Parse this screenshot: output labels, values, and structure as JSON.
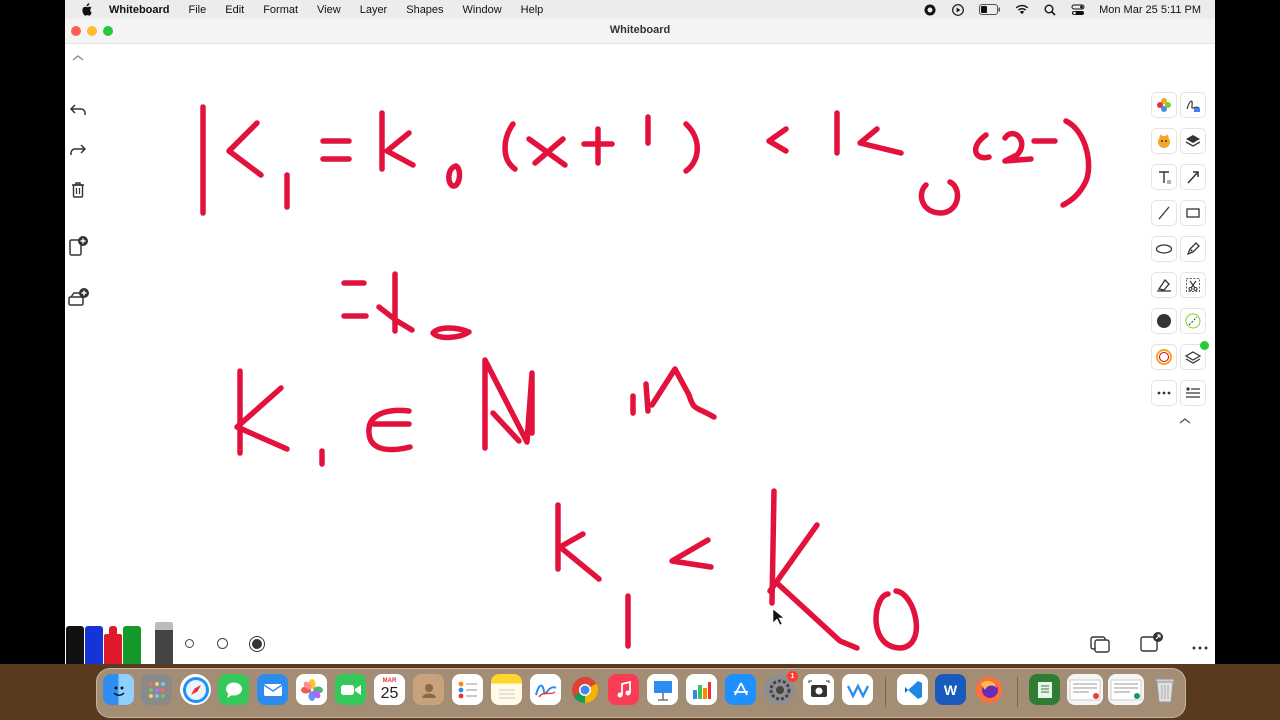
{
  "menubar": {
    "app_name": "Whiteboard",
    "menus": [
      "File",
      "Edit",
      "Format",
      "View",
      "Layer",
      "Shapes",
      "Window",
      "Help"
    ],
    "datetime": "Mon Mar 25  5:11 PM"
  },
  "window": {
    "title": "Whiteboard"
  },
  "dock": {
    "calendar_month": "MAR",
    "calendar_day": "25",
    "settings_badge": "1",
    "word_letter": "W"
  },
  "colors": {
    "ink": "#e3123d",
    "marker_colors": [
      "#111111",
      "#1534d6",
      "#e01a2c",
      "#159a2a"
    ]
  }
}
